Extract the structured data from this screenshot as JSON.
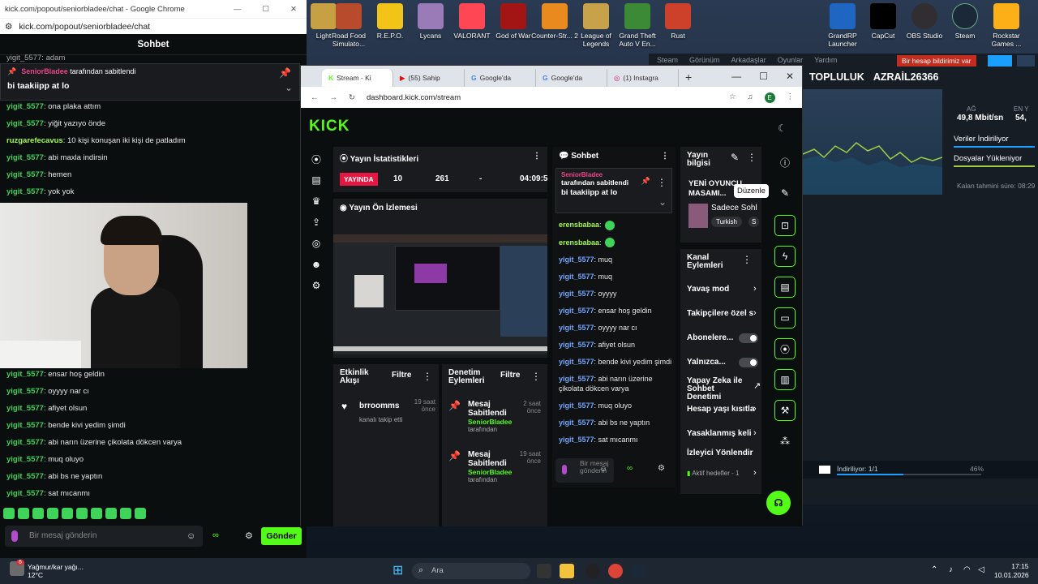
{
  "desktop_icons": [
    {
      "label": "Light",
      "color": "#c7a043"
    },
    {
      "label": "Road Food Simulato...",
      "color": "#b84b2c"
    },
    {
      "label": "R.E.P.O.",
      "color": "#f2c417"
    },
    {
      "label": "Lycans",
      "color": "#9a7bb8"
    },
    {
      "label": "VALORANT",
      "color": "#ff4655"
    },
    {
      "label": "God of War",
      "color": "#a31515"
    },
    {
      "label": "Counter-Str... 2",
      "color": "#e98a1f"
    },
    {
      "label": "League of Legends",
      "color": "#c8a24b"
    },
    {
      "label": "Grand Theft Auto V En...",
      "color": "#3c8a35"
    },
    {
      "label": "Rust",
      "color": "#cd412b"
    },
    {
      "label": "GrandRP Launcher",
      "color": "#1e66c2"
    },
    {
      "label": "CapCut",
      "color": "#000000"
    },
    {
      "label": "OBS Studio",
      "color": "#302e31"
    },
    {
      "label": "Steam",
      "color": "#1b2838"
    },
    {
      "label": "Rockstar Games ...",
      "color": "#fcaf17"
    }
  ],
  "steam": {
    "menu": [
      "Steam",
      "Görünüm",
      "Arkadaşlar",
      "Oyunlar",
      "Yardım"
    ],
    "report": "Bir hesap bildirimiz var",
    "nav_community": "TOPLULUK",
    "nav_user": "AZRAİL26366",
    "net_label": "AĞ",
    "net_value": "49,8 Mbit/sn",
    "net_label2": "EN Y",
    "net_value2": "54,",
    "legend_download": "Veriler İndiriliyor",
    "legend_disk": "Dosyalar Yükleniyor",
    "remaining": "Kalan tahmini süre: 08:29",
    "downloading": "İndiriliyor: 1/1",
    "percent": "46%",
    "progress": 0.46
  },
  "popout": {
    "title": "kick.com/popout/seniorbladee/chat - Google Chrome",
    "url": "kick.com/popout/seniorbladee/chat",
    "header": "Sohbet",
    "pinned_by": "SeniorBladee",
    "pinned_suffix": "tarafından sabitlendi",
    "pinned_msg": "bi taakiipp at lo",
    "top_line": "yigit_5577: adam",
    "messages_top": [
      {
        "user": "yigit_5577",
        "text": ": ona plaka attım",
        "color": "green"
      },
      {
        "user": "yigit_5577",
        "text": ": yiğit yazıyo önde",
        "color": "green"
      },
      {
        "user": "ruzgarefecavus",
        "text": ": 10 kişi konuşan iki kişi de patladım",
        "color": "lime"
      },
      {
        "user": "yigit_5577",
        "text": ": abi maxla indirsin",
        "color": "green"
      },
      {
        "user": "yigit_5577",
        "text": ": hemen",
        "color": "green"
      },
      {
        "user": "yigit_5577",
        "text": ": yok yok",
        "color": "green"
      }
    ],
    "messages_bottom": [
      {
        "user": "yigit_5577",
        "text": ": ensar hoş geldin"
      },
      {
        "user": "yigit_5577",
        "text": ": oyyyy nar cı"
      },
      {
        "user": "yigit_5577",
        "text": ": afiyet olsun"
      },
      {
        "user": "yigit_5577",
        "text": ": bende kivi yedim şimdi"
      },
      {
        "user": "yigit_5577",
        "text": ": abi narın üzerine çikolata dökcen varya"
      },
      {
        "user": "yigit_5577",
        "text": ": muq oluyo"
      },
      {
        "user": "yigit_5577",
        "text": ": abi bs ne yaptın"
      },
      {
        "user": "yigit_5577",
        "text": ": sat mıcanmı"
      }
    ],
    "input_placeholder": "Bir mesaj gönderin",
    "send": "Gönder"
  },
  "dash": {
    "tabs": [
      "Stream - Ki",
      "(55) Sahip",
      "Google'da",
      "Google'da",
      "(1) Instagra"
    ],
    "url": "dashboard.kick.com/stream",
    "logo": "KICK",
    "stats_title": "Yayın İstatistikleri",
    "live_badge": "YAYINDA",
    "stat_viewers": "10",
    "stat_followers": "261",
    "stat_dash": "-",
    "stat_time": "04:09:5",
    "preview_title": "Yayın Ön İzlemesi",
    "activity_title": "Etkinlik Akışı",
    "activity_filter": "Filtre",
    "activity_user": "brroomms",
    "activity_time": "19 saat önce",
    "activity_text": "kanalı takip etti",
    "mod_title": "Denetim Eylemleri",
    "mod_filter": "Filtre",
    "mod_items": [
      {
        "action": "Mesaj Sabitlendi",
        "user": "SeniorBladee",
        "suffix": "tarafından",
        "time": "2 saat önce"
      },
      {
        "action": "Mesaj Sabitlendi",
        "user": "SeniorBladee",
        "suffix": "tarafından",
        "time": "19 saat önce"
      }
    ],
    "chat_title": "Sohbet",
    "chat_pinned_by": "SeniorBladee",
    "chat_pinned_suffix": "tarafından sabitlendi",
    "chat_pinned_msg": "bi taakiipp at lo",
    "chat_messages": [
      {
        "user": "erensbabaa",
        "text": ":",
        "color": "lime"
      },
      {
        "user": "erensbabaa",
        "text": ":",
        "color": "lime"
      },
      {
        "user": "yigit_5577",
        "text": ": muq",
        "color": "blue"
      },
      {
        "user": "yigit_5577",
        "text": ": muq",
        "color": "blue"
      },
      {
        "user": "yigit_5577",
        "text": ": oyyyy",
        "color": "blue"
      },
      {
        "user": "yigit_5577",
        "text": ": ensar hoş geldin",
        "color": "blue"
      },
      {
        "user": "yigit_5577",
        "text": ": oyyyy nar cı",
        "color": "blue"
      },
      {
        "user": "yigit_5577",
        "text": ": afiyet olsun",
        "color": "blue"
      },
      {
        "user": "yigit_5577",
        "text": ": bende kivi yedim şimdi",
        "color": "blue"
      },
      {
        "user": "yigit_5577",
        "text": ": abi narın üzerine çikolata dökcen varya",
        "color": "blue"
      },
      {
        "user": "yigit_5577",
        "text": ": muq oluyo",
        "color": "blue"
      },
      {
        "user": "yigit_5577",
        "text": ": abi bs ne yaptın",
        "color": "blue"
      },
      {
        "user": "yigit_5577",
        "text": ": sat mıcanmı",
        "color": "blue"
      }
    ],
    "chat_placeholder": "Bir mesaj gönderin",
    "info_title": "Yayın bilgisi",
    "info_stream_title": "YENİ OYUNCU MASAMI...",
    "info_category": "Sadece Sohl",
    "info_tag1": "Turkish",
    "info_tag2": "S",
    "tooltip": "Düzenle",
    "actions_title": "Kanal Eylemleri",
    "actions": [
      "Yavaş mod",
      "Takipçilere özel s",
      "Abonelere...",
      "Yalnızca...",
      "Yapay Zeka ile Sohbet Denetimi",
      "Hesap yaşı kısıtla",
      "Yasaklanmış keli",
      "İzleyici Yönlendir"
    ],
    "actions_footer": "Aktif hedefler - 1"
  },
  "taskbar": {
    "weather_title": "Yağmur/kar yağı...",
    "weather_temp": "12°C",
    "search": "Ara",
    "time": "17:15",
    "date": "10.01.2026",
    "notif": "6"
  }
}
